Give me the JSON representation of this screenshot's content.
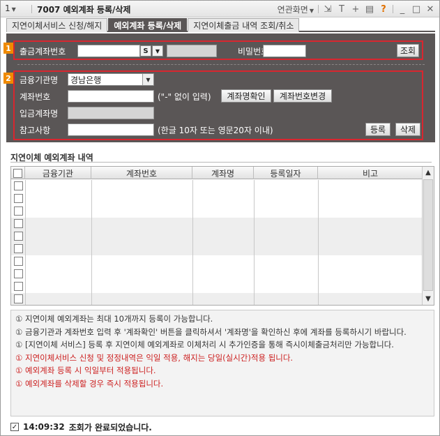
{
  "titlebar": {
    "screen_no": "1",
    "title": "7007 예외계좌 등록/삭제",
    "related_label": "연관화면"
  },
  "tabs": [
    {
      "label": "지연이체서비스 신청/해지",
      "active": false
    },
    {
      "label": "예외계좌 등록/삭제",
      "active": true
    },
    {
      "label": "지연이체출금 내역 조회/취소",
      "active": false
    }
  ],
  "section1": {
    "badge": "1",
    "account_label": "출금계좌번호",
    "account_type": "S",
    "password_label": "비밀번호",
    "query_button": "조회"
  },
  "section2": {
    "badge": "2",
    "bank_label": "금융기관명",
    "bank_value": "경남은행",
    "acct_no_label": "계좌번호",
    "acct_no_hint": "(\"-\" 없이 입력)",
    "check_name_button": "계좌명확인",
    "change_acct_button": "계좌번호변경",
    "deposit_name_label": "입금계좌명",
    "memo_label": "참고사항",
    "memo_hint": "(한글 10자 또는 영문20자 이내)",
    "register_button": "등록",
    "delete_button": "삭제"
  },
  "list": {
    "title": "지연이체 예외계좌 내역",
    "columns": [
      "금융기관",
      "계좌번호",
      "계좌명",
      "등록일자",
      "비고"
    ],
    "rows": []
  },
  "notes": [
    {
      "mark": "①",
      "text": "지연이체 예외계좌는 최대 10개까지 등록이 가능합니다.",
      "red": false
    },
    {
      "mark": "①",
      "text": "금융기관과 계좌번호 입력 후 '계좌확인' 버튼을 클릭하셔서 '계좌명'을 확인하신 후에 계좌를 등록하시기 바랍니다.",
      "red": false
    },
    {
      "mark": "①",
      "text": "[지연이체 서비스] 등록 후 지연이체 예외계좌로 이체처리 시 추가인증을 통해 즉시이체출금처리만 가능합니다.",
      "red": false
    },
    {
      "mark": "①",
      "text": "지연이체서비스 신청 및 정정내역은 익일 적용, 해지는 당일(실시간)적용 됩니다.",
      "red": true
    },
    {
      "mark": "①",
      "text": "예외계좌 등록 시 익일부터 적용됩니다.",
      "red": true
    },
    {
      "mark": "①",
      "text": "예외계좌를 삭제할 경우 즉시 적용됩니다.",
      "red": true
    }
  ],
  "status": {
    "time": "14:09:32",
    "message": "조회가 완료되었습니다."
  },
  "colors": {
    "panel": "#5a5656",
    "highlight_border": "#d9262f",
    "badge": "#f08a00",
    "note_red": "#cc2020"
  }
}
